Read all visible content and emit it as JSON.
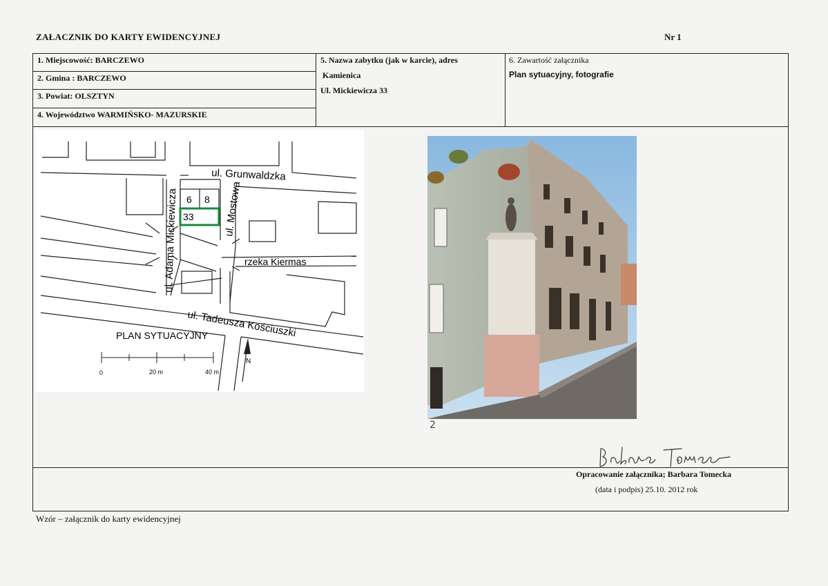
{
  "header": {
    "title": "ZAŁACZNIK DO KARTY EWIDENCYJNEJ",
    "number": "Nr 1"
  },
  "table": {
    "miejscowosc": "1. Miejscowość: BARCZEWO",
    "gmina": "2. Gmina : BARCZEWO",
    "powiat": "3. Powiat: OLSZTYN",
    "wojewodztwo": "4. Województwo WARMIŃSKO- MAZURSKIE",
    "nazwa_label": "5. Nazwa zabytku (jak w karcie), adres",
    "nazwa_value": "Kamienica",
    "adres_value": "Ul. Mickiewicza 33",
    "zawartosc_label": "6. Zawartość załącznika",
    "zawartosc_value": "Plan sytuacyjny, fotografie"
  },
  "map": {
    "street_grunwaldzka": "ul. Grunwaldzka",
    "street_mickiewicza": "ul. Adama Mickiewicza",
    "street_mostowa": "ul. Mostowa",
    "river": "rzeka Kiermas",
    "street_kosciuszki": "ul. Tadeusza Kościuszki",
    "plot_6": "6",
    "plot_8": "8",
    "plot_33": "33",
    "plan_title": "PLAN SYTUACYJNY",
    "scale_0": "0",
    "scale_20": "20 m",
    "scale_40": "40 m",
    "north": "N",
    "highlight_color": "#1a8a3a"
  },
  "photo": {
    "number": "2"
  },
  "signature": {
    "handwritten": "Barbara Tomecka",
    "credit": "Opracowanie załącznika; Barbara Tomecka",
    "date": "(data i podpis) 25.10. 2012 rok"
  },
  "footer": {
    "text": "Wzór – załącznik do karty ewidencyjnej"
  }
}
